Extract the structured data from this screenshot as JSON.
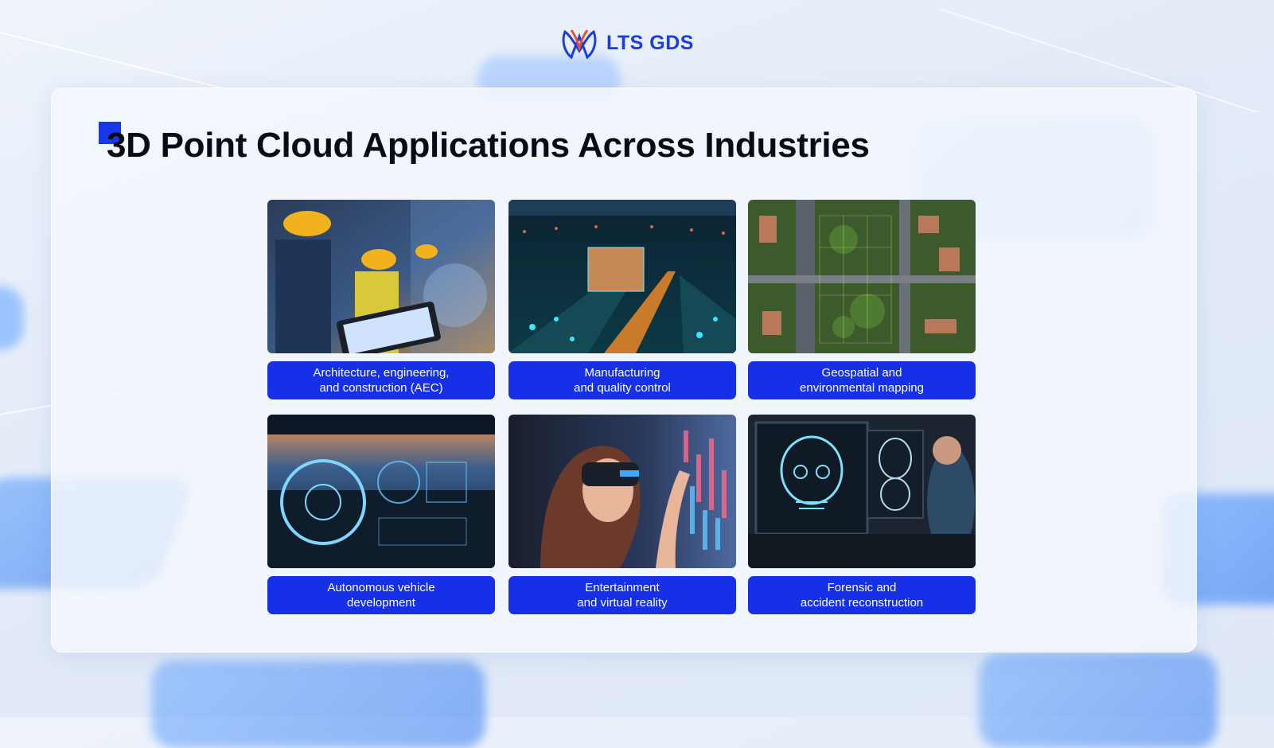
{
  "brand": {
    "name": "LTS GDS",
    "color": "#1a3fd8",
    "accent": "#1530e6"
  },
  "slide": {
    "title": "3D Point Cloud Applications Across Industries"
  },
  "industries": [
    {
      "label": "Architecture, engineering,\nand construction (AEC)",
      "image": "workers-with-tablet-image"
    },
    {
      "label": "Manufacturing\nand quality control",
      "image": "factory-conveyor-image"
    },
    {
      "label": "Geospatial and\nenvironmental mapping",
      "image": "aerial-map-image"
    },
    {
      "label": "Autonomous vehicle\ndevelopment",
      "image": "car-dashboard-image"
    },
    {
      "label": "Entertainment\nand virtual reality",
      "image": "vr-headset-image"
    },
    {
      "label": "Forensic and\naccident reconstruction",
      "image": "skull-scan-image"
    }
  ]
}
